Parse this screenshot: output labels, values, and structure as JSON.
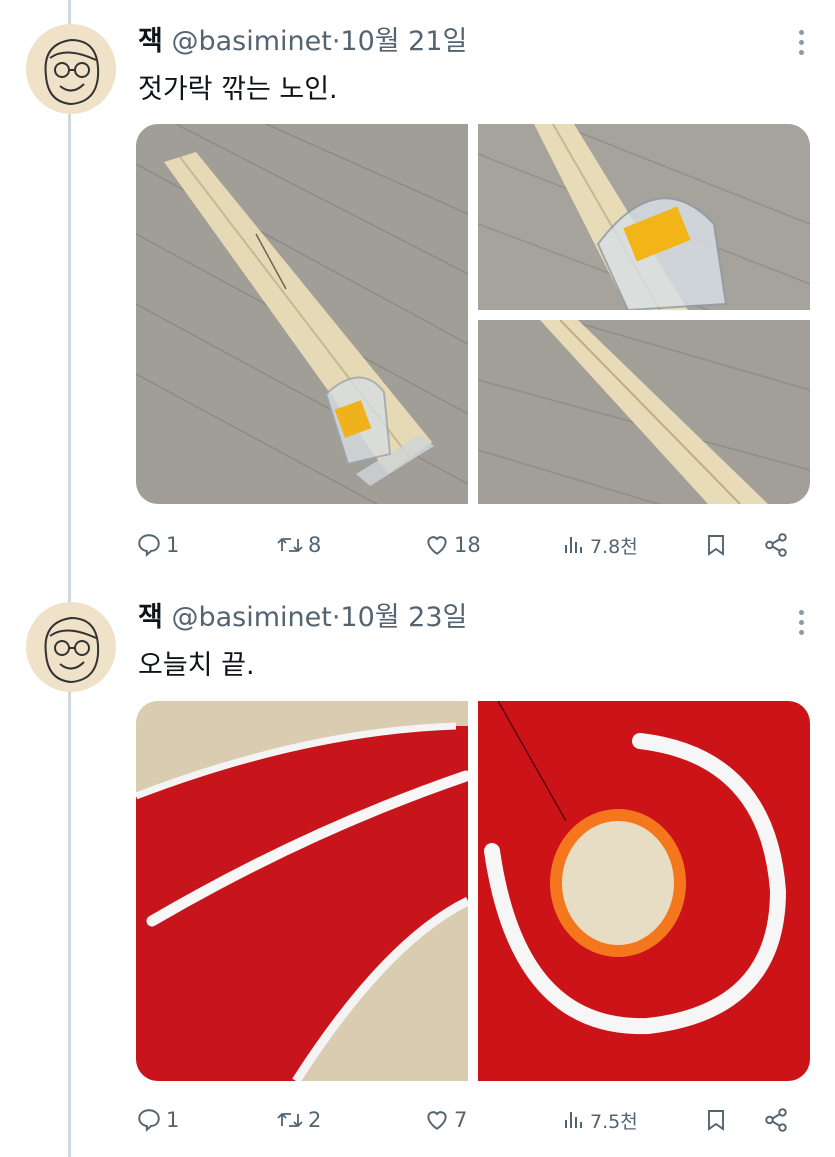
{
  "tweets": [
    {
      "name": "잭",
      "handle": "@basiminet",
      "dot": "·",
      "date": "10월 21일",
      "text": "젓가락 깎는 노인.",
      "actions": {
        "replies": "1",
        "reposts": "8",
        "likes": "18",
        "views": "7.8천"
      },
      "icons": [
        "reply-icon",
        "repost-icon",
        "like-icon",
        "views-icon",
        "bookmark-icon",
        "share-icon"
      ]
    },
    {
      "name": "잭",
      "handle": "@basiminet",
      "dot": "·",
      "date": "10월 23일",
      "text": "오늘치 끝.",
      "actions": {
        "replies": "1",
        "reposts": "2",
        "likes": "7",
        "views": "7.5천"
      },
      "icons": [
        "reply-icon",
        "repost-icon",
        "like-icon",
        "views-icon",
        "bookmark-icon",
        "share-icon"
      ]
    }
  ],
  "colors": {
    "thread_line": "#cfd9de",
    "secondary_text": "#536471",
    "felt_red": "#c8151b",
    "wood_floor": "#9a9690"
  }
}
